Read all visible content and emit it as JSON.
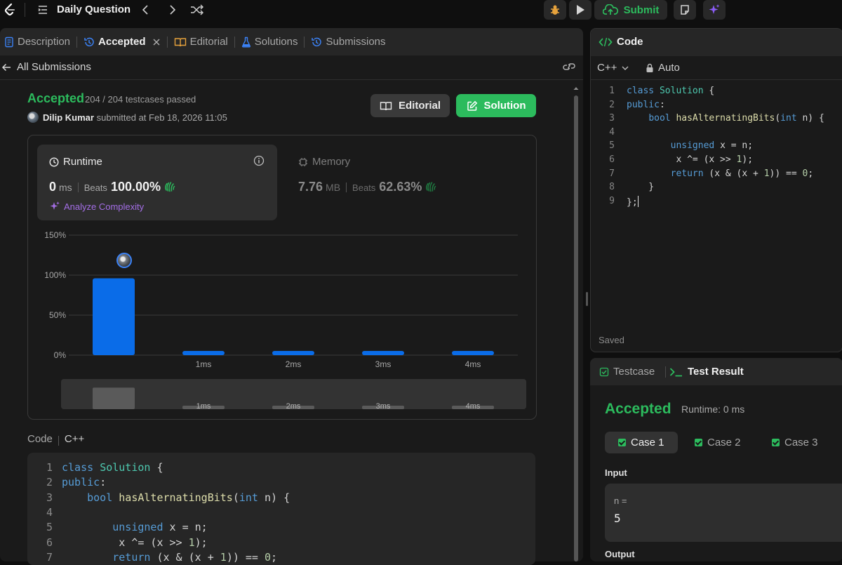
{
  "topbar": {
    "title": "Daily Question",
    "submit_label": "Submit"
  },
  "tabs": [
    {
      "label": "Description"
    },
    {
      "label": "Accepted"
    },
    {
      "label": "Editorial"
    },
    {
      "label": "Solutions"
    },
    {
      "label": "Submissions"
    }
  ],
  "submission": {
    "all_submissions_label": "All Submissions",
    "status": "Accepted",
    "testcases": "204 / 204 testcases passed",
    "user": "Dilip Kumar",
    "submitted_text": "submitted at Feb 18, 2026 11:05",
    "editorial_button": "Editorial",
    "solution_button": "Solution"
  },
  "runtime": {
    "label": "Runtime",
    "value": "0",
    "unit": "ms",
    "beats_label": "Beats",
    "beats": "100.00%",
    "analyze_label": "Analyze Complexity"
  },
  "memory": {
    "label": "Memory",
    "value": "7.76",
    "unit": "MB",
    "beats_label": "Beats",
    "beats": "62.63%"
  },
  "chart_data": {
    "type": "bar",
    "categories": [
      "0ms",
      "1ms",
      "2ms",
      "3ms",
      "4ms"
    ],
    "values": [
      96,
      2,
      2,
      2,
      2
    ],
    "y_ticks": [
      "0%",
      "50%",
      "100%",
      "150%"
    ],
    "ylim": [
      0,
      150
    ],
    "x_tick_labels": [
      "",
      "1ms",
      "2ms",
      "3ms",
      "4ms"
    ],
    "highlight_index": 0,
    "grid": true,
    "bar_color": "#0a6ce8",
    "overview_bar_color": "#5a5a5a",
    "overview_labels": [
      "",
      "1ms",
      "2ms",
      "3ms",
      "4ms"
    ]
  },
  "code_section": {
    "label": "Code",
    "language": "C++",
    "lines": [
      "class Solution {",
      "public:",
      "    bool hasAlternatingBits(int n) {",
      "",
      "        unsigned x = n;",
      "         x ^= (x >> 1);",
      "        return (x & (x + 1)) == 0;"
    ]
  },
  "editor": {
    "title": "Code",
    "language": "C++",
    "mode": "Auto",
    "saved_label": "Saved",
    "lines": [
      "class Solution {",
      "public:",
      "    bool hasAlternatingBits(int n) {",
      "",
      "        unsigned x = n;",
      "         x ^= (x >> 1);",
      "        return (x & (x + 1)) == 0;",
      "    }",
      "};"
    ]
  },
  "test_result": {
    "tab_testcase": "Testcase",
    "tab_result": "Test Result",
    "status": "Accepted",
    "runtime": "Runtime: 0 ms",
    "cases": [
      "Case 1",
      "Case 2",
      "Case 3"
    ],
    "active_case": 0,
    "input_label": "Input",
    "var_name": "n =",
    "var_value": "5",
    "output_label": "Output"
  },
  "colors": {
    "accent_green": "#2cbb5d",
    "bar_blue": "#0a6ce8",
    "purple": "#a46ee6"
  },
  "icons": [
    "leetcode-logo-icon",
    "list-icon",
    "chevron-left-icon",
    "chevron-right-icon",
    "shuffle-icon",
    "debug-icon",
    "play-icon",
    "cloud-upload-icon",
    "note-icon",
    "sparkle-icon"
  ]
}
